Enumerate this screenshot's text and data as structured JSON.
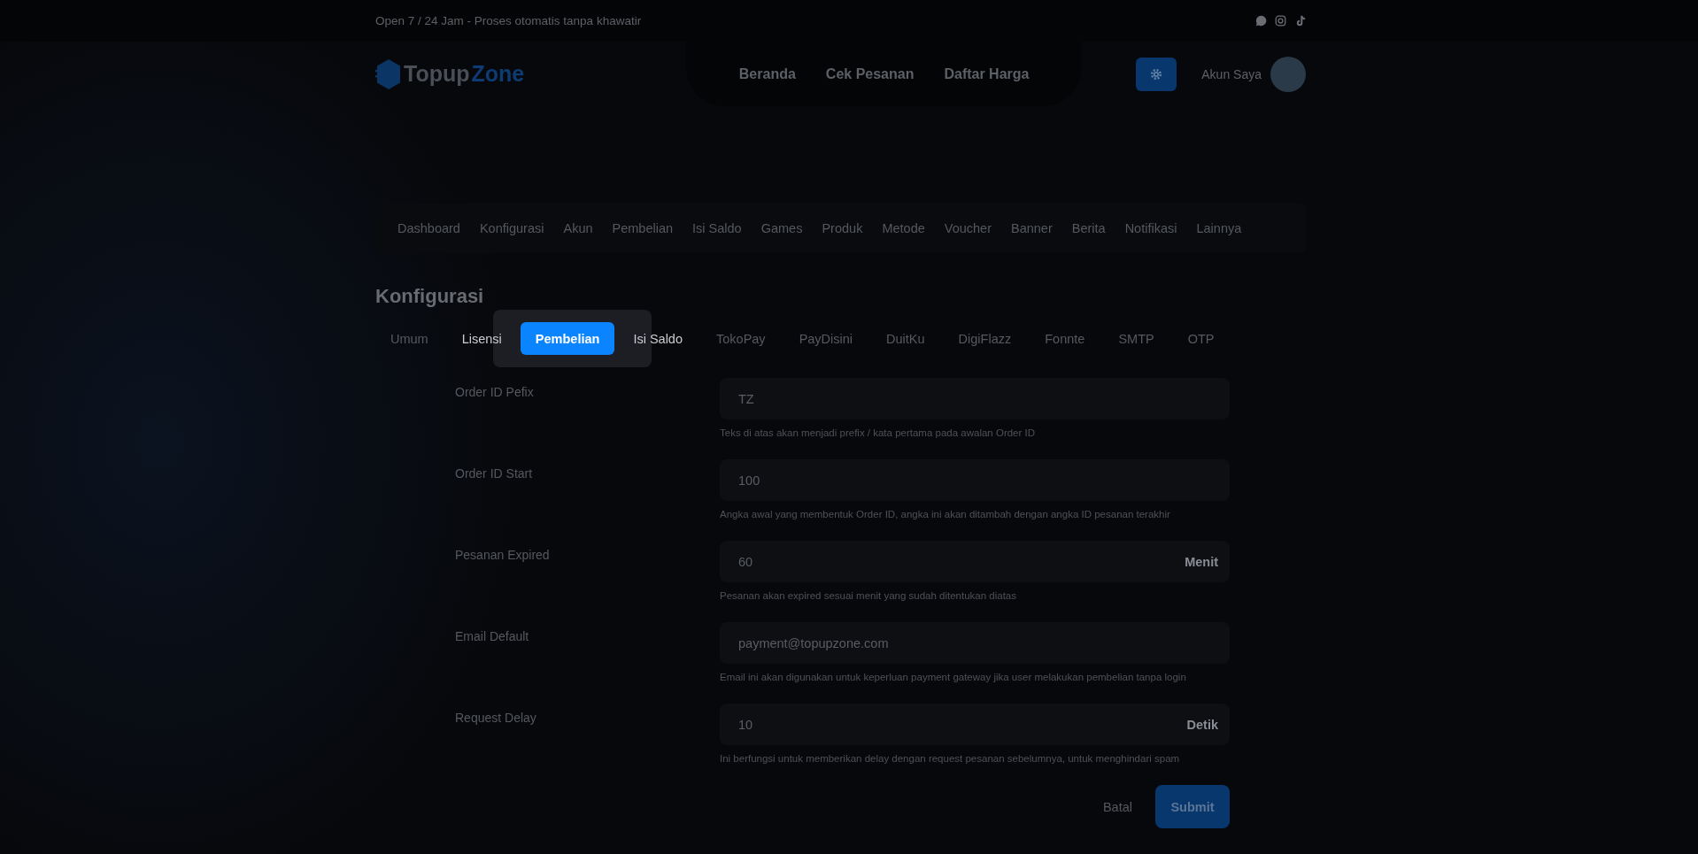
{
  "top_bar": {
    "tagline": "Open 7 / 24 Jam - Proses otomatis tanpa khawatir"
  },
  "header": {
    "logo": {
      "part_1": "Topup",
      "part_2": "Zone"
    },
    "nav": [
      "Beranda",
      "Cek Pesanan",
      "Daftar Harga"
    ],
    "account_label": "Akun Saya"
  },
  "admin_menu": [
    "Dashboard",
    "Konfigurasi",
    "Akun",
    "Pembelian",
    "Isi Saldo",
    "Games",
    "Produk",
    "Metode",
    "Voucher",
    "Banner",
    "Berita",
    "Notifikasi",
    "Lainnya"
  ],
  "page_title": "Konfigurasi",
  "tabs": [
    {
      "label": "Umum",
      "selected": false
    },
    {
      "label": "Lisensi",
      "selected": false
    },
    {
      "label": "Pembelian",
      "selected": true
    },
    {
      "label": "Isi Saldo",
      "selected": false
    },
    {
      "label": "TokoPay",
      "selected": false
    },
    {
      "label": "PayDisini",
      "selected": false
    },
    {
      "label": "DuitKu",
      "selected": false
    },
    {
      "label": "DigiFlazz",
      "selected": false
    },
    {
      "label": "Fonnte",
      "selected": false
    },
    {
      "label": "SMTP",
      "selected": false
    },
    {
      "label": "OTP",
      "selected": false
    }
  ],
  "fields": [
    {
      "label": "Order ID Pefix",
      "value": "TZ",
      "help": "Teks di atas akan menjadi prefix / kata pertama pada awalan Order ID"
    },
    {
      "label": "Order ID Start",
      "value": "100",
      "help": "Angka awal yang membentuk Order ID, angka ini akan ditambah dengan angka ID pesanan terakhir"
    },
    {
      "label": "Pesanan Expired",
      "value": "60",
      "unit": "Menit",
      "help": "Pesanan akan expired sesuai menit yang sudah ditentukan diatas"
    },
    {
      "label": "Email Default",
      "value": "payment@topupzone.com",
      "help": "Email ini akan digunakan untuk keperluan payment gateway jika user melakukan pembelian tanpa login"
    },
    {
      "label": "Request Delay",
      "value": "10",
      "unit": "Detik",
      "help": "Ini berfungsi untuk memberikan delay dengan request pesanan sebelumnya, untuk menghindari spam"
    }
  ],
  "actions": {
    "cancel": "Batal",
    "submit": "Submit"
  }
}
